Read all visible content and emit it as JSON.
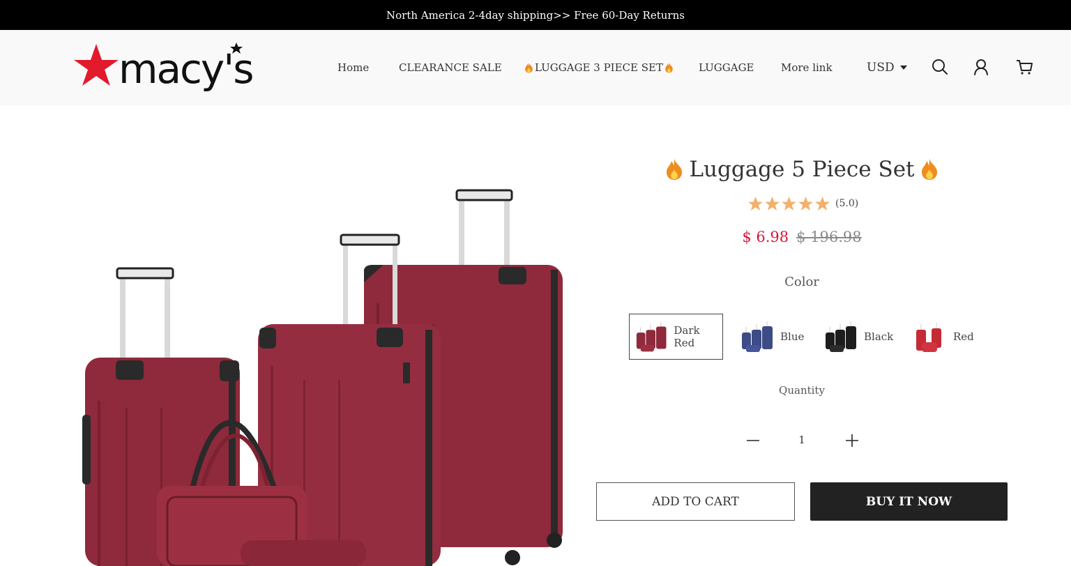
{
  "announcement": "North America 2-4day shipping>> Free 60-Day Returns",
  "logo": {
    "text": "macy's",
    "color": "#e21a2c"
  },
  "nav": {
    "home": "Home",
    "clearance": "CLEARANCE SALE",
    "luggage_set": "LUGGAGE 3 PIECE SET",
    "luggage": "LUGGAGE",
    "more": "More link"
  },
  "currency": "USD",
  "icons": [
    "search-icon",
    "account-icon",
    "cart-icon",
    "flame-icon",
    "star-icon",
    "minus-icon",
    "plus-icon"
  ],
  "product": {
    "title": "Luggage 5 Piece Set",
    "rating": 5,
    "rating_label": "(5.0)",
    "sale_price": "$ 6.98",
    "original_price": "$ 196.98",
    "color_label": "Color",
    "colors": [
      {
        "name": "Dark Red",
        "hex": "#8e2a3b",
        "selected": true
      },
      {
        "name": "Blue",
        "hex": "#3d4b86",
        "selected": false
      },
      {
        "name": "Black",
        "hex": "#1d1d1d",
        "selected": false
      },
      {
        "name": "Red",
        "hex": "#c52a35",
        "selected": false
      }
    ],
    "quantity_label": "Quantity",
    "quantity": "1",
    "add_to_cart": "ADD TO CART",
    "buy_now": "BUY IT NOW"
  },
  "colors": {
    "sale": "#d5173a",
    "star": "#f2b06d",
    "button_dark": "#222222",
    "flame": "#f08c1e"
  }
}
